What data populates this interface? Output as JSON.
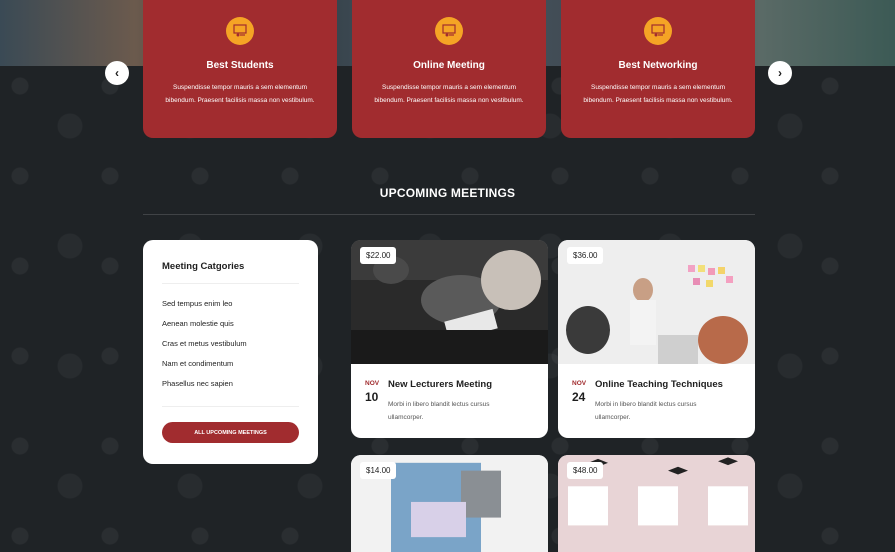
{
  "services": [
    {
      "title": "Best Students",
      "text": "Suspendisse tempor mauris a sem elementum bibendum. Praesent facilisis massa non vestibulum.",
      "icon": "teacher-board-icon"
    },
    {
      "title": "Online Meeting",
      "text": "Suspendisse tempor mauris a sem elementum bibendum. Praesent facilisis massa non vestibulum.",
      "icon": "teacher-board-icon"
    },
    {
      "title": "Best Networking",
      "text": "Suspendisse tempor mauris a sem elementum bibendum. Praesent facilisis massa non vestibulum.",
      "icon": "teacher-board-icon"
    }
  ],
  "nav": {
    "prev": "‹",
    "next": "›"
  },
  "section_title": "UPCOMING MEETINGS",
  "categories": {
    "title": "Meeting Catgories",
    "items": [
      "Sed tempus enim leo",
      "Aenean molestie quis",
      "Cras et metus vestibulum",
      "Nam et condimentum",
      "Phasellus nec sapien"
    ],
    "button": "ALL UPCOMING MEETINGS"
  },
  "meetings": [
    {
      "price": "$22.00",
      "month": "NOV",
      "day": "10",
      "title": "New Lecturers Meeting",
      "desc": "Morbi in libero blandit lectus cursus ullamcorper."
    },
    {
      "price": "$36.00",
      "month": "NOV",
      "day": "24",
      "title": "Online Teaching Techniques",
      "desc": "Morbi in libero blandit lectus cursus ullamcorper."
    }
  ],
  "bottom_meetings": [
    {
      "price": "$14.00"
    },
    {
      "price": "$48.00"
    }
  ],
  "colors": {
    "accent": "#a12c2f",
    "icon": "#f5a425",
    "background": "#1f2326"
  }
}
